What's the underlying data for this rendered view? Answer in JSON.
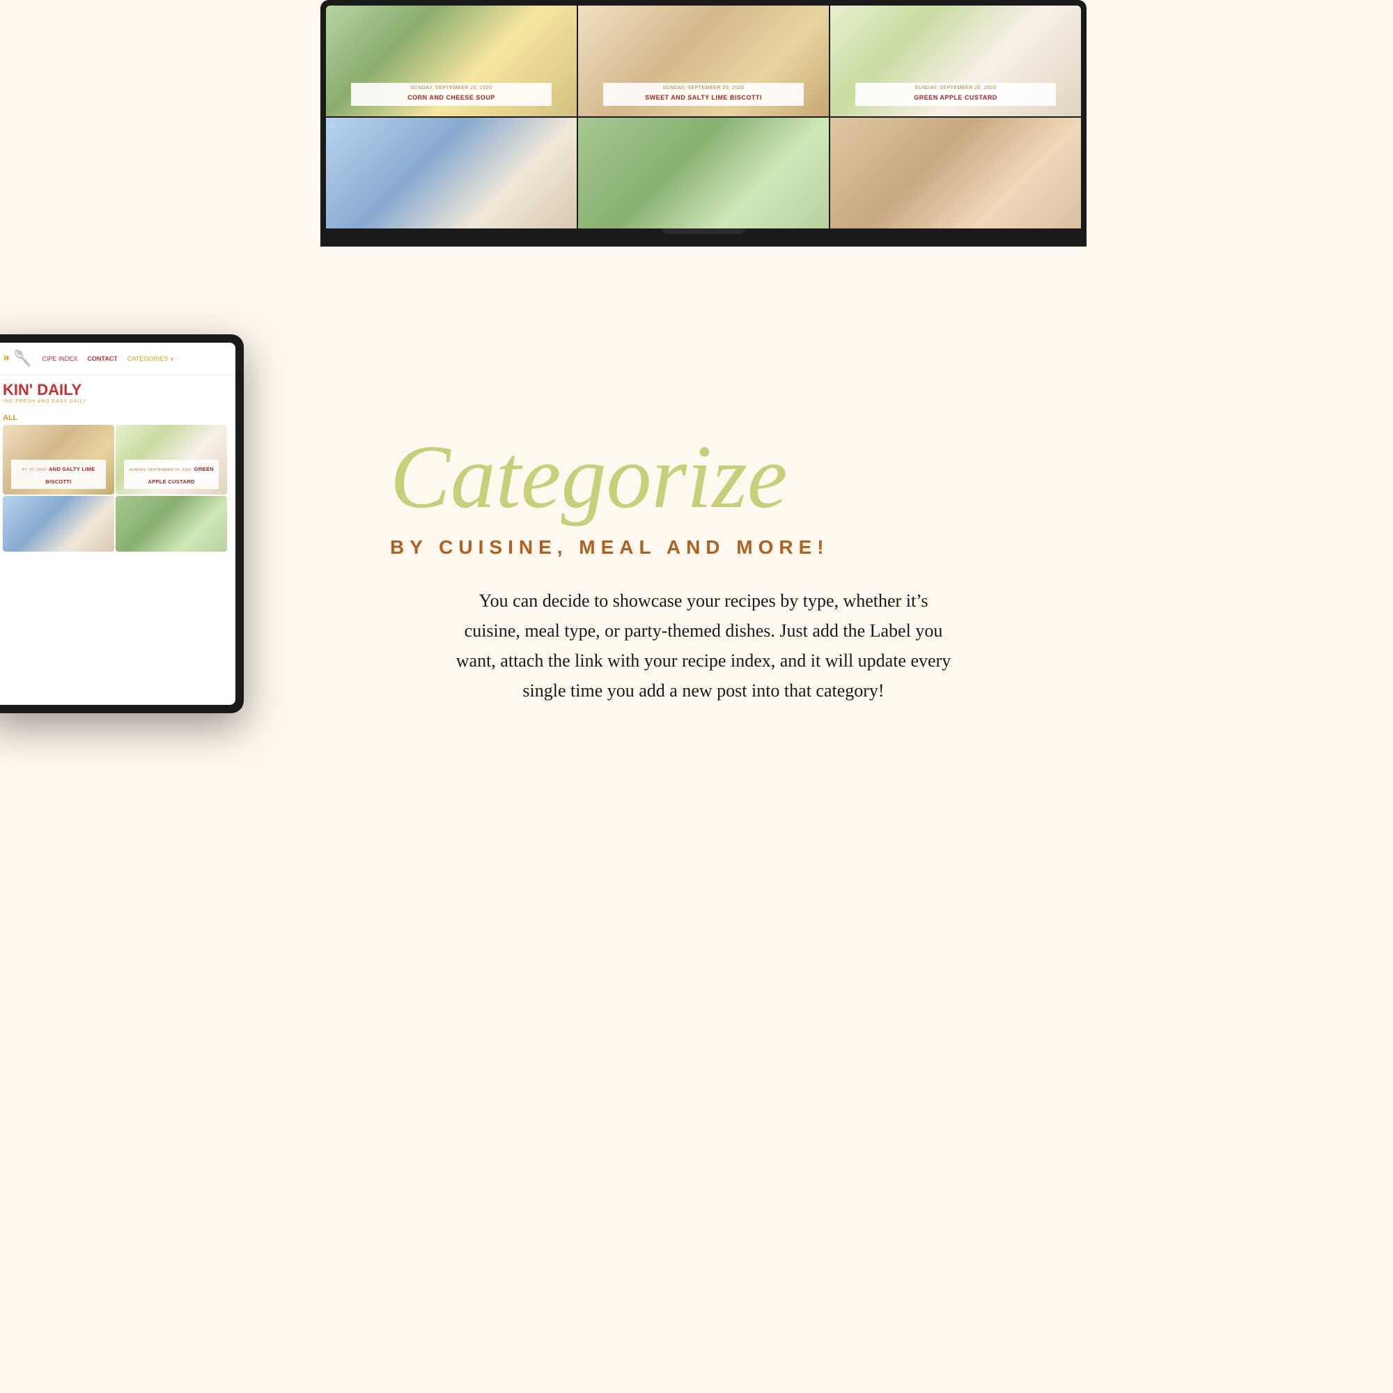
{
  "background": {
    "color": "#fff8ee"
  },
  "laptop": {
    "grid_rows": [
      [
        {
          "date": "Sunday, September 20, 2020",
          "title": "Corn and Cheese Soup",
          "food_class": "food-soup"
        },
        {
          "date": "Sunday, September 20, 2020",
          "title": "Sweet and Salty Lime Biscotti",
          "food_class": "food-biscotti"
        },
        {
          "date": "Sunday, September 20, 2020",
          "title": "Green Apple Custard",
          "food_class": "food-apple"
        }
      ],
      [
        {
          "date": "",
          "title": "",
          "food_class": "food-colorful2"
        },
        {
          "date": "",
          "title": "",
          "food_class": "food-green"
        },
        {
          "date": "",
          "title": "",
          "food_class": "food-warm"
        }
      ]
    ]
  },
  "tablet": {
    "nav": {
      "recipe_index": "CIPE INDEX",
      "contact": "CONTACT",
      "categories": "CATEGORIES ∨"
    },
    "blog_title": "KIN' DAILY",
    "blog_subtitle": "ING FRESH AND EASY DAILY",
    "filter_label": "ALL",
    "grid": [
      {
        "date": "PT. 27, 2020",
        "title": "AND SALTY LIME BISCOTTI",
        "food_class": "food-biscotti"
      },
      {
        "date": "Sunday, September 20, 2020",
        "title": "GREEN APPLE CUSTARD",
        "food_class": "food-apple"
      }
    ],
    "bottom_grid": [
      {
        "food_class": "food-colorful2"
      },
      {
        "food_class": "food-green"
      }
    ]
  },
  "right_content": {
    "categorize_title": "Categorize",
    "subtitle": "BY CUISINE, MEAL AND MORE!",
    "description": "You can decide to showcase your recipes by type, whether it’s cuisine, meal type, or party-themed dishes. Just add the Label you want, attach the link with your recipe index, and it will update every single time you add a new post into that category!"
  }
}
